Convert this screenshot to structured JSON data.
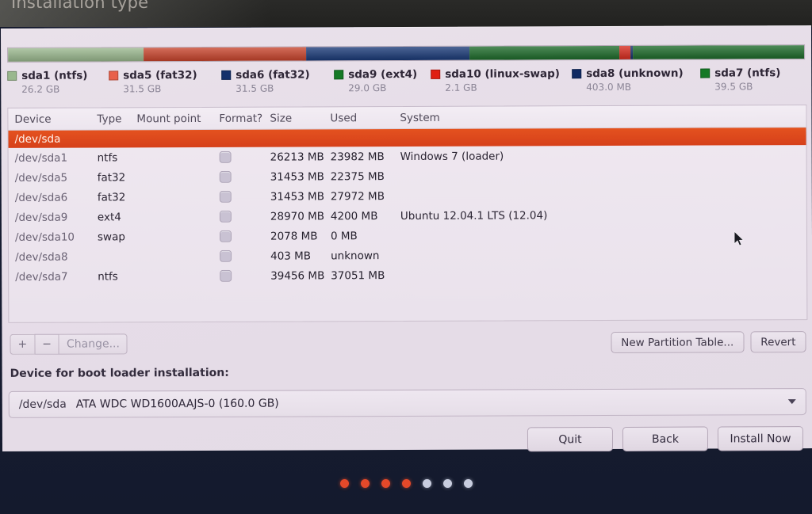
{
  "window": {
    "title": "Installation type"
  },
  "partition_bar": {
    "segments": [
      {
        "name": "sda1",
        "percent": 17.0,
        "color": "#9ab88e"
      },
      {
        "name": "sda5",
        "percent": 20.5,
        "color": "#c8442c"
      },
      {
        "name": "sda6",
        "percent": 20.5,
        "color": "#1a3a78"
      },
      {
        "name": "sda9",
        "percent": 18.8,
        "color": "#1d6b2a"
      },
      {
        "name": "sda10",
        "percent": 1.4,
        "color": "#d82b1e"
      },
      {
        "name": "sda8",
        "percent": 0.3,
        "color": "#13306b"
      },
      {
        "name": "sda7",
        "percent": 21.5,
        "color": "#1d6b2a"
      }
    ]
  },
  "legend": [
    {
      "label": "sda1 (ntfs)",
      "size": "26.2 GB",
      "color": "#9ab88e"
    },
    {
      "label": "sda5 (fat32)",
      "size": "31.5 GB",
      "color": "#e8604a"
    },
    {
      "label": "sda6 (fat32)",
      "size": "31.5 GB",
      "color": "#13306b"
    },
    {
      "label": "sda9 (ext4)",
      "size": "29.0 GB",
      "color": "#157a26"
    },
    {
      "label": "sda10 (linux-swap)",
      "size": "2.1 GB",
      "color": "#e01f12"
    },
    {
      "label": "sda8 (unknown)",
      "size": "403.0 MB",
      "color": "#102a63"
    },
    {
      "label": "sda7 (ntfs)",
      "size": "39.5 GB",
      "color": "#157a26"
    }
  ],
  "table": {
    "columns": [
      "Device",
      "Type",
      "Mount point",
      "Format?",
      "Size",
      "Used",
      "System"
    ],
    "disk_row": {
      "device": "/dev/sda"
    },
    "rows": [
      {
        "device": "/dev/sda1",
        "type": "ntfs",
        "mount": "",
        "format": false,
        "size": "26213 MB",
        "used": "23982 MB",
        "system": "Windows 7 (loader)"
      },
      {
        "device": "/dev/sda5",
        "type": "fat32",
        "mount": "",
        "format": false,
        "size": "31453 MB",
        "used": "22375 MB",
        "system": ""
      },
      {
        "device": "/dev/sda6",
        "type": "fat32",
        "mount": "",
        "format": false,
        "size": "31453 MB",
        "used": "27972 MB",
        "system": ""
      },
      {
        "device": "/dev/sda9",
        "type": "ext4",
        "mount": "",
        "format": false,
        "size": "28970 MB",
        "used": "4200 MB",
        "system": "Ubuntu 12.04.1 LTS (12.04)"
      },
      {
        "device": "/dev/sda10",
        "type": "swap",
        "mount": "",
        "format": false,
        "size": "2078 MB",
        "used": "0 MB",
        "system": ""
      },
      {
        "device": "/dev/sda8",
        "type": "",
        "mount": "",
        "format": false,
        "size": "403 MB",
        "used": "unknown",
        "system": ""
      },
      {
        "device": "/dev/sda7",
        "type": "ntfs",
        "mount": "",
        "format": false,
        "size": "39456 MB",
        "used": "37051 MB",
        "system": ""
      }
    ]
  },
  "toolbar": {
    "add_label": "+",
    "remove_label": "−",
    "change_label": "Change...",
    "new_partition_table_label": "New Partition Table...",
    "revert_label": "Revert"
  },
  "bootloader": {
    "label": "Device for boot loader installation:",
    "selected_device": "/dev/sda",
    "selected_description": "ATA WDC WD1600AAJS-0 (160.0 GB)"
  },
  "actions": {
    "quit_label": "Quit",
    "back_label": "Back",
    "install_label": "Install Now"
  },
  "progress_dots": {
    "total": 7,
    "active": 4
  },
  "colors": {
    "accent": "#e4521f",
    "window_bg": "#e7dfe9",
    "desktop_bg": "#141a2e"
  }
}
